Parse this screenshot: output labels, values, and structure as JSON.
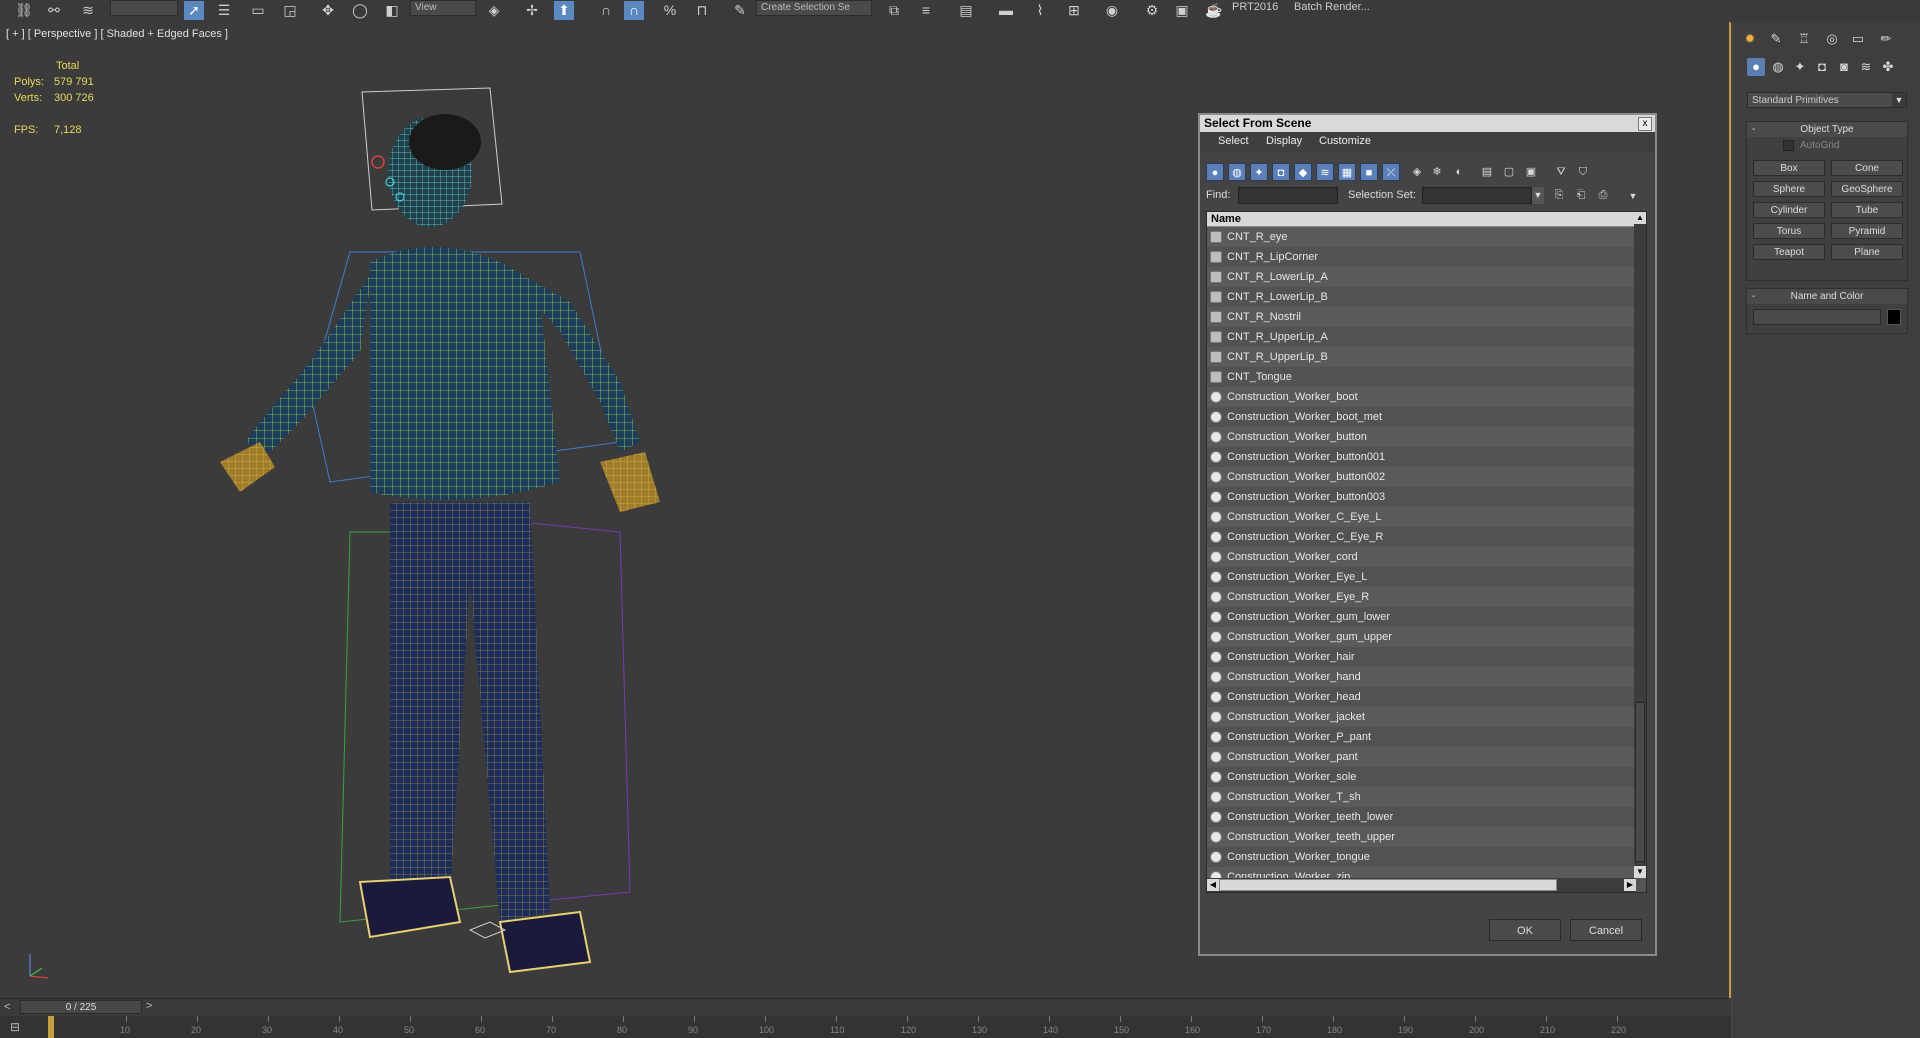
{
  "toolbar": {
    "view_combo": "View",
    "selection_set_combo": "Create Selection Se",
    "prt_label": "PRT2016",
    "batch_render_label": "Batch Render..."
  },
  "viewport": {
    "label": "[ + ] [ Perspective ] [ Shaded + Edged Faces ]",
    "stats": {
      "total_label": "Total",
      "polys_label": "Polys:",
      "polys_value": "579 791",
      "verts_label": "Verts:",
      "verts_value": "300 726",
      "fps_label": "FPS:",
      "fps_value": "7,128"
    }
  },
  "dialog": {
    "title": "Select From Scene",
    "close": "x",
    "menu": [
      "Select",
      "Display",
      "Customize"
    ],
    "find_label": "Find:",
    "find_value": "",
    "selection_set_label": "Selection Set:",
    "selection_set_value": "",
    "column_header": "Name",
    "items": [
      {
        "name": "CNT_R_eye",
        "type": "bone"
      },
      {
        "name": "CNT_R_LipCorner",
        "type": "bone"
      },
      {
        "name": "CNT_R_LowerLip_A",
        "type": "bone"
      },
      {
        "name": "CNT_R_LowerLip_B",
        "type": "bone"
      },
      {
        "name": "CNT_R_Nostril",
        "type": "bone"
      },
      {
        "name": "CNT_R_UpperLip_A",
        "type": "bone"
      },
      {
        "name": "CNT_R_UpperLip_B",
        "type": "bone"
      },
      {
        "name": "CNT_Tongue",
        "type": "bone"
      },
      {
        "name": "Construction_Worker_boot",
        "type": "geometry"
      },
      {
        "name": "Construction_Worker_boot_met",
        "type": "geometry"
      },
      {
        "name": "Construction_Worker_button",
        "type": "geometry"
      },
      {
        "name": "Construction_Worker_button001",
        "type": "geometry"
      },
      {
        "name": "Construction_Worker_button002",
        "type": "geometry"
      },
      {
        "name": "Construction_Worker_button003",
        "type": "geometry"
      },
      {
        "name": "Construction_Worker_C_Eye_L",
        "type": "geometry"
      },
      {
        "name": "Construction_Worker_C_Eye_R",
        "type": "geometry"
      },
      {
        "name": "Construction_Worker_cord",
        "type": "geometry"
      },
      {
        "name": "Construction_Worker_Eye_L",
        "type": "geometry"
      },
      {
        "name": "Construction_Worker_Eye_R",
        "type": "geometry"
      },
      {
        "name": "Construction_Worker_gum_lower",
        "type": "geometry"
      },
      {
        "name": "Construction_Worker_gum_upper",
        "type": "geometry"
      },
      {
        "name": "Construction_Worker_hair",
        "type": "geometry"
      },
      {
        "name": "Construction_Worker_hand",
        "type": "geometry"
      },
      {
        "name": "Construction_Worker_head",
        "type": "geometry"
      },
      {
        "name": "Construction_Worker_jacket",
        "type": "geometry"
      },
      {
        "name": "Construction_Worker_P_pant",
        "type": "geometry"
      },
      {
        "name": "Construction_Worker_pant",
        "type": "geometry"
      },
      {
        "name": "Construction_Worker_sole",
        "type": "geometry"
      },
      {
        "name": "Construction_Worker_T_sh",
        "type": "geometry"
      },
      {
        "name": "Construction_Worker_teeth_lower",
        "type": "geometry"
      },
      {
        "name": "Construction_Worker_teeth_upper",
        "type": "geometry"
      },
      {
        "name": "Construction_Worker_tongue",
        "type": "geometry"
      },
      {
        "name": "Construction_Worker_zip",
        "type": "geometry"
      }
    ],
    "ok_label": "OK",
    "cancel_label": "Cancel"
  },
  "command_panel": {
    "category": "Standard Primitives",
    "object_type_title": "Object Type",
    "autogrid_label": "AutoGrid",
    "primitives": [
      "Box",
      "Cone",
      "Sphere",
      "GeoSphere",
      "Cylinder",
      "Tube",
      "Torus",
      "Pyramid",
      "Teapot",
      "Plane"
    ],
    "name_color_title": "Name and Color",
    "name_value": ""
  },
  "timeline": {
    "frame_display": "0 / 225",
    "prev": "<",
    "next": ">",
    "ticks": [
      "10",
      "20",
      "30",
      "40",
      "50",
      "60",
      "70",
      "80",
      "90",
      "100",
      "110",
      "120",
      "130",
      "140",
      "150",
      "160",
      "170",
      "180",
      "190",
      "200",
      "210",
      "220"
    ]
  }
}
